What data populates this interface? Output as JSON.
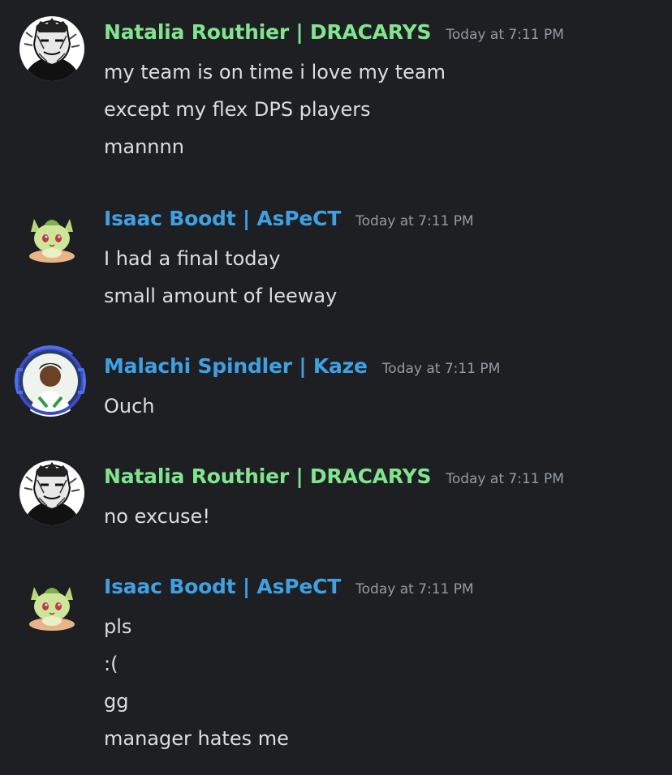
{
  "colors": {
    "background": "#1e1f22",
    "name_green": "#80e58e",
    "name_blue": "#3fa0e2",
    "timestamp": "#949ba4",
    "message_text": "#dbdee1"
  },
  "messages": [
    {
      "username": "Natalia Routhier | DRACARYS",
      "timestamp": "Today at 7:11 PM",
      "avatar_icon": "sketch-portrait-avatar",
      "lines": [
        "my team is on time i love my team",
        "except my flex DPS players",
        "mannnn"
      ]
    },
    {
      "username": "Isaac Boodt | AsPeCT",
      "timestamp": "Today at 7:11 PM",
      "avatar_icon": "sprigatito-avatar",
      "lines": [
        "I had a final today",
        "small amount of leeway"
      ]
    },
    {
      "username": "Malachi Spindler | Kaze",
      "timestamp": "Today at 7:11 PM",
      "avatar_icon": "headset-frame-photo-avatar",
      "lines": [
        "Ouch"
      ]
    },
    {
      "username": "Natalia Routhier | DRACARYS",
      "timestamp": "Today at 7:11 PM",
      "avatar_icon": "sketch-portrait-avatar",
      "lines": [
        "no excuse!"
      ]
    },
    {
      "username": "Isaac Boodt | AsPeCT",
      "timestamp": "Today at 7:11 PM",
      "avatar_icon": "sprigatito-avatar",
      "lines": [
        "pls",
        ":(",
        "gg",
        "manager hates me"
      ]
    }
  ]
}
